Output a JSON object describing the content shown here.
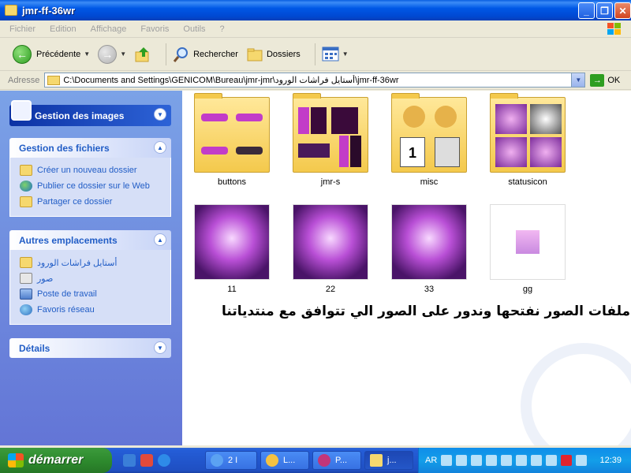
{
  "window": {
    "title": "jmr-ff-36wr"
  },
  "menu": [
    "Fichier",
    "Edition",
    "Affichage",
    "Favoris",
    "Outils",
    "?"
  ],
  "toolbar": {
    "back_label": "Précédente",
    "search_label": "Rechercher",
    "folders_label": "Dossiers"
  },
  "address": {
    "label": "Adresse",
    "path": "C:\\Documents and Settings\\GENICOM\\Bureau\\jmr-jmr\\أستايل فراشات الورود\\jmr-ff-36wr",
    "go_label": "OK"
  },
  "leftpane": {
    "image_tasks": "Gestion des images",
    "file_tasks": {
      "title": "Gestion des fichiers",
      "items": [
        "Créer un nouveau dossier",
        "Publier ce dossier sur le Web",
        "Partager ce dossier"
      ]
    },
    "other_places": {
      "title": "Autres emplacements",
      "items": [
        "أستايل فراشات الورود",
        "صور",
        "Poste de travail",
        "Favoris réseau"
      ]
    },
    "details": "Détails"
  },
  "content": {
    "items": [
      {
        "label": "buttons",
        "kind": "folder"
      },
      {
        "label": "jmr-s",
        "kind": "folder"
      },
      {
        "label": "misc",
        "kind": "folder"
      },
      {
        "label": "statusicon",
        "kind": "folder"
      },
      {
        "label": "11",
        "kind": "image"
      },
      {
        "label": "22",
        "kind": "image"
      },
      {
        "label": "33",
        "kind": "image"
      },
      {
        "label": "gg",
        "kind": "image"
      }
    ],
    "overlay_text": "تظهر ملفات الصور نفتحها وندور على الصور الي تتوافق مع منتدياتنا"
  },
  "taskbar": {
    "start_label": "démarrer",
    "tasks": [
      "2 I",
      "L...",
      "P...",
      "j..."
    ],
    "language": "AR",
    "clock": "12:39"
  },
  "colors": {
    "titlebar": "#0058E6",
    "leftpane": "#7BA2E7",
    "link": "#215DC6",
    "start": "#2E8B2E"
  }
}
